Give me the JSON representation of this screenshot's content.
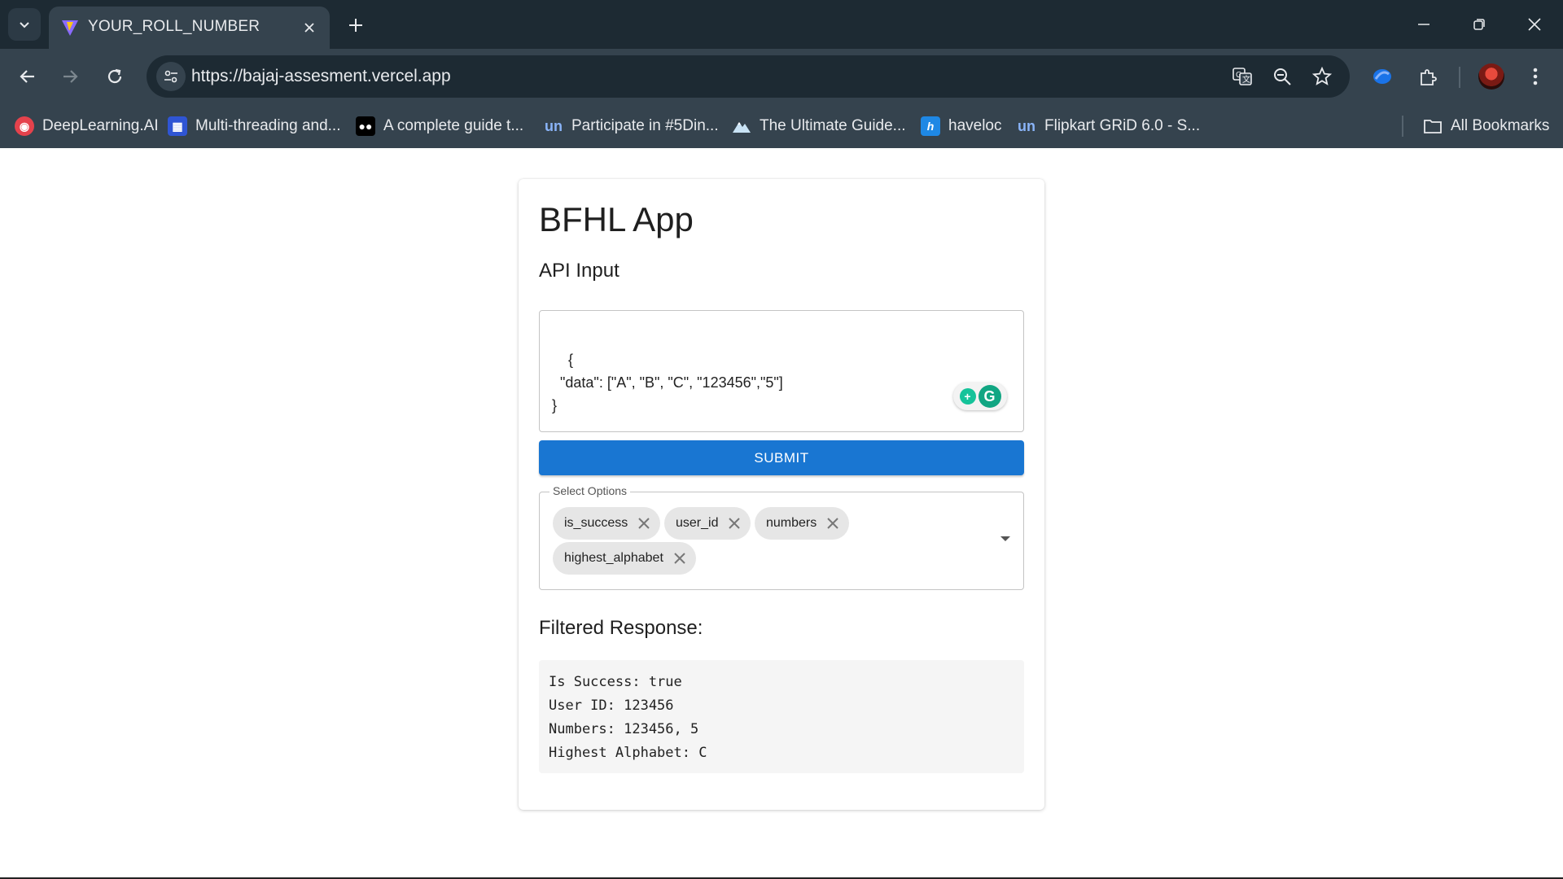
{
  "browser": {
    "tab_title": "YOUR_ROLL_NUMBER",
    "url": "https://bajaj-assesment.vercel.app"
  },
  "bookmarks": [
    {
      "label": "DeepLearning.AI",
      "icon": "deeplearning-icon",
      "color": "#e5424c"
    },
    {
      "label": "Multi-threading and...",
      "icon": "blocks-icon",
      "color": "#2f55d4"
    },
    {
      "label": "A complete guide t...",
      "icon": "medium-icon",
      "color": "#000000"
    },
    {
      "label": "Participate in #5Din...",
      "icon": "unstop-icon",
      "color": "#1c4980"
    },
    {
      "label": "The Ultimate Guide...",
      "icon": "mountain-icon",
      "color": "#c9e3f5"
    },
    {
      "label": "haveloc",
      "icon": "haveloc-icon",
      "color": "#1e88e5"
    },
    {
      "label": "Flipkart GRiD 6.0 - S...",
      "icon": "unstop-icon",
      "color": "#1c4980"
    }
  ],
  "all_bookmarks_label": "All Bookmarks",
  "app": {
    "title": "BFHL App",
    "input_label": "API Input",
    "input_value": "{\n  \"data\": [\"A\", \"B\", \"C\", \"123456\",\"5\"]\n}",
    "submit_label": "SUBMIT",
    "select_label": "Select Options",
    "chips": [
      "is_success",
      "user_id",
      "numbers",
      "highest_alphabet"
    ],
    "response_title": "Filtered Response:",
    "response_lines": [
      "Is Success: true",
      "User ID: 123456",
      "Numbers: 123456, 5",
      "Highest Alphabet: C"
    ]
  },
  "colors": {
    "accent": "#1976d2",
    "chrome_bg": "#35434e",
    "tabstrip_bg": "#1d2a33"
  }
}
